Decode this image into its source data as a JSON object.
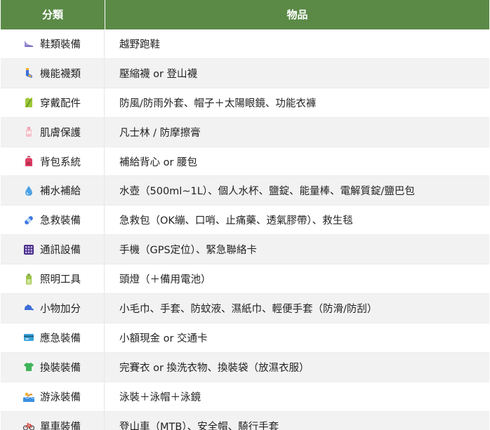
{
  "header": {
    "category": "分類",
    "item": "物品"
  },
  "rows": [
    {
      "icon": "shoe-icon",
      "category": "鞋類裝備",
      "item": "越野跑鞋"
    },
    {
      "icon": "socks-icon",
      "category": "機能襪類",
      "item": "壓縮襪 or 登山襪"
    },
    {
      "icon": "clothing-icon",
      "category": "穿戴配件",
      "item": "防風/防雨外套、帽子＋太陽眼鏡、功能衣褲"
    },
    {
      "icon": "lotion-bottle-icon",
      "category": "肌膚保護",
      "item": "凡士林 / 防摩擦膏"
    },
    {
      "icon": "backpack-icon",
      "category": "背包系統",
      "item": "補給背心 or 腰包"
    },
    {
      "icon": "water-drop-icon",
      "category": "補水補給",
      "item": "水壺（500ml~1L）、個人水杯、鹽錠、能量棒、電解質錠/鹽巴包"
    },
    {
      "icon": "bandage-icon",
      "category": "急救裝備",
      "item": "急救包（OK繃、口哨、止痛藥、透氣膠帶）、救生毯"
    },
    {
      "icon": "phone-keypad-icon",
      "category": "通訊設備",
      "item": "手機（GPS定位）、緊急聯絡卡"
    },
    {
      "icon": "battery-icon",
      "category": "照明工具",
      "item": "頭燈（＋備用電池）"
    },
    {
      "icon": "cap-icon",
      "category": "小物加分",
      "item": "小毛巾、手套、防蚊液、濕紙巾、輕便手套（防滑/防刮）"
    },
    {
      "icon": "credit-card-icon",
      "category": "應急裝備",
      "item": "小額現金 or 交通卡"
    },
    {
      "icon": "tshirt-icon",
      "category": "換裝裝備",
      "item": "完賽衣 or 換洗衣物、換裝袋（放濕衣服）"
    },
    {
      "icon": "swimmer-icon",
      "category": "游泳裝備",
      "item": "泳裝＋泳帽＋泳鏡"
    },
    {
      "icon": "bicycle-icon",
      "category": "單車裝備",
      "item": "登山車（MTB）、安全帽、騎行手套"
    }
  ]
}
